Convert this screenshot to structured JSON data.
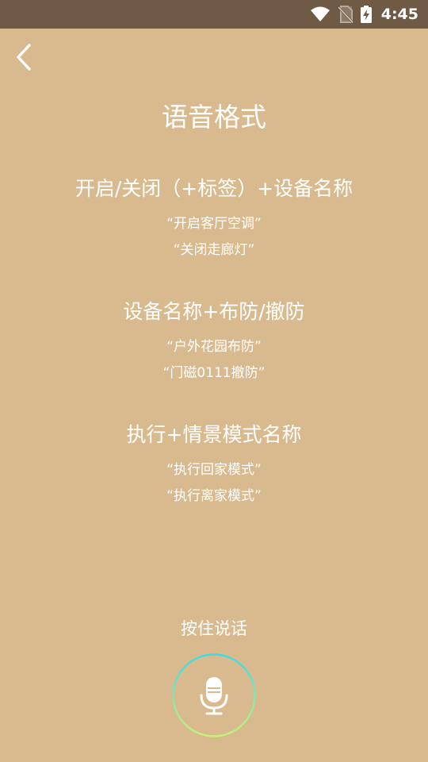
{
  "status_bar": {
    "time": "4:45",
    "icons": [
      "wifi-icon",
      "no-sim-icon",
      "battery-charging-icon"
    ]
  },
  "header": {
    "back_icon": "chevron-left-icon",
    "title": "语音格式"
  },
  "sections": [
    {
      "heading": "开启/关闭（+标签）+设备名称",
      "examples": [
        "“开启客厅空调”",
        "“关闭走廊灯”"
      ]
    },
    {
      "heading": "设备名称+布防/撤防",
      "examples": [
        "“户外花园布防”",
        "“门磁0111撤防”"
      ]
    },
    {
      "heading": "执行+情景模式名称",
      "examples": [
        "“执行回家模式”",
        "“执行离家模式”"
      ]
    }
  ],
  "voice": {
    "hold_label": "按住说话",
    "mic_icon": "microphone-icon"
  },
  "colors": {
    "background": "#D9BA8E",
    "status_bar": "#6E5A45",
    "text": "#FFFFFF",
    "ring_gradient_start": "#3FD9E6",
    "ring_gradient_end": "#C8F07A"
  }
}
